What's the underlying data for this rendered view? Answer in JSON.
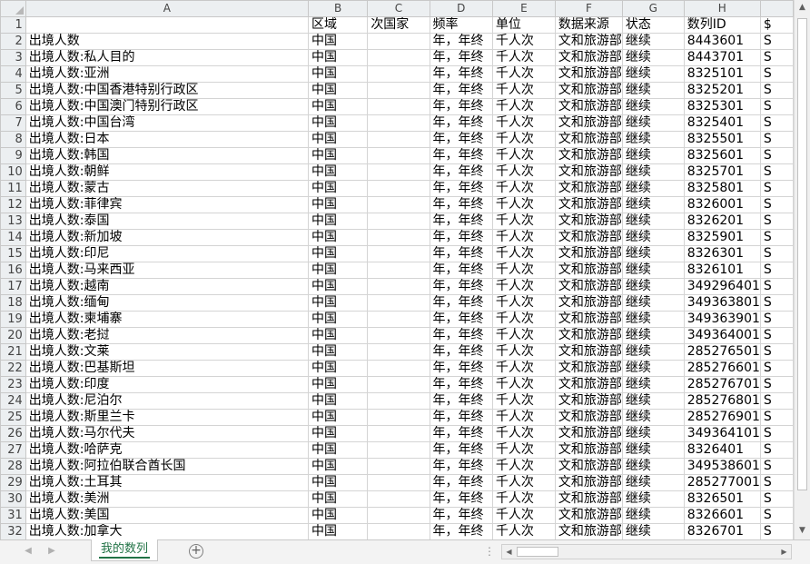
{
  "columns": [
    "A",
    "B",
    "C",
    "D",
    "E",
    "F",
    "G",
    "H",
    ""
  ],
  "header_row": {
    "num": "1",
    "cells": [
      "",
      "区域",
      "次国家",
      "频率",
      "单位",
      "数据来源",
      "状态",
      "数列ID",
      "$"
    ]
  },
  "rows": [
    {
      "num": "2",
      "cells": [
        "出境人数",
        "中国",
        "",
        "年，年终",
        "千人次",
        "文和旅游部",
        "继续",
        "8443601",
        "S"
      ]
    },
    {
      "num": "3",
      "cells": [
        "出境人数:私人目的",
        "中国",
        "",
        "年，年终",
        "千人次",
        "文和旅游部",
        "继续",
        "8443701",
        "S"
      ]
    },
    {
      "num": "4",
      "cells": [
        "出境人数:亚洲",
        "中国",
        "",
        "年，年终",
        "千人次",
        "文和旅游部",
        "继续",
        "8325101",
        "S"
      ]
    },
    {
      "num": "5",
      "cells": [
        "出境人数:中国香港特别行政区",
        "中国",
        "",
        "年，年终",
        "千人次",
        "文和旅游部",
        "继续",
        "8325201",
        "S"
      ]
    },
    {
      "num": "6",
      "cells": [
        "出境人数:中国澳门特别行政区",
        "中国",
        "",
        "年，年终",
        "千人次",
        "文和旅游部",
        "继续",
        "8325301",
        "S"
      ]
    },
    {
      "num": "7",
      "cells": [
        "出境人数:中国台湾",
        "中国",
        "",
        "年，年终",
        "千人次",
        "文和旅游部",
        "继续",
        "8325401",
        "S"
      ]
    },
    {
      "num": "8",
      "cells": [
        "出境人数:日本",
        "中国",
        "",
        "年，年终",
        "千人次",
        "文和旅游部",
        "继续",
        "8325501",
        "S"
      ]
    },
    {
      "num": "9",
      "cells": [
        "出境人数:韩国",
        "中国",
        "",
        "年，年终",
        "千人次",
        "文和旅游部",
        "继续",
        "8325601",
        "S"
      ]
    },
    {
      "num": "10",
      "cells": [
        "出境人数:朝鲜",
        "中国",
        "",
        "年，年终",
        "千人次",
        "文和旅游部",
        "继续",
        "8325701",
        "S"
      ]
    },
    {
      "num": "11",
      "cells": [
        "出境人数:蒙古",
        "中国",
        "",
        "年，年终",
        "千人次",
        "文和旅游部",
        "继续",
        "8325801",
        "S"
      ]
    },
    {
      "num": "12",
      "cells": [
        "出境人数:菲律宾",
        "中国",
        "",
        "年，年终",
        "千人次",
        "文和旅游部",
        "继续",
        "8326001",
        "S"
      ]
    },
    {
      "num": "13",
      "cells": [
        "出境人数:泰国",
        "中国",
        "",
        "年，年终",
        "千人次",
        "文和旅游部",
        "继续",
        "8326201",
        "S"
      ]
    },
    {
      "num": "14",
      "cells": [
        "出境人数:新加坡",
        "中国",
        "",
        "年，年终",
        "千人次",
        "文和旅游部",
        "继续",
        "8325901",
        "S"
      ]
    },
    {
      "num": "15",
      "cells": [
        "出境人数:印尼",
        "中国",
        "",
        "年，年终",
        "千人次",
        "文和旅游部",
        "继续",
        "8326301",
        "S"
      ]
    },
    {
      "num": "16",
      "cells": [
        "出境人数:马来西亚",
        "中国",
        "",
        "年，年终",
        "千人次",
        "文和旅游部",
        "继续",
        "8326101",
        "S"
      ]
    },
    {
      "num": "17",
      "cells": [
        "出境人数:越南",
        "中国",
        "",
        "年，年终",
        "千人次",
        "文和旅游部",
        "继续",
        "349296401",
        "S"
      ]
    },
    {
      "num": "18",
      "cells": [
        "出境人数:缅甸",
        "中国",
        "",
        "年，年终",
        "千人次",
        "文和旅游部",
        "继续",
        "349363801",
        "S"
      ]
    },
    {
      "num": "19",
      "cells": [
        "出境人数:柬埔寨",
        "中国",
        "",
        "年，年终",
        "千人次",
        "文和旅游部",
        "继续",
        "349363901",
        "S"
      ]
    },
    {
      "num": "20",
      "cells": [
        "出境人数:老挝",
        "中国",
        "",
        "年，年终",
        "千人次",
        "文和旅游部",
        "继续",
        "349364001",
        "S"
      ]
    },
    {
      "num": "21",
      "cells": [
        "出境人数:文莱",
        "中国",
        "",
        "年，年终",
        "千人次",
        "文和旅游部",
        "继续",
        "285276501",
        "S"
      ]
    },
    {
      "num": "22",
      "cells": [
        "出境人数:巴基斯坦",
        "中国",
        "",
        "年，年终",
        "千人次",
        "文和旅游部",
        "继续",
        "285276601",
        "S"
      ]
    },
    {
      "num": "23",
      "cells": [
        "出境人数:印度",
        "中国",
        "",
        "年，年终",
        "千人次",
        "文和旅游部",
        "继续",
        "285276701",
        "S"
      ]
    },
    {
      "num": "24",
      "cells": [
        "出境人数:尼泊尔",
        "中国",
        "",
        "年，年终",
        "千人次",
        "文和旅游部",
        "继续",
        "285276801",
        "S"
      ]
    },
    {
      "num": "25",
      "cells": [
        "出境人数:斯里兰卡",
        "中国",
        "",
        "年，年终",
        "千人次",
        "文和旅游部",
        "继续",
        "285276901",
        "S"
      ]
    },
    {
      "num": "26",
      "cells": [
        "出境人数:马尔代夫",
        "中国",
        "",
        "年，年终",
        "千人次",
        "文和旅游部",
        "继续",
        "349364101",
        "S"
      ]
    },
    {
      "num": "27",
      "cells": [
        "出境人数:哈萨克",
        "中国",
        "",
        "年，年终",
        "千人次",
        "文和旅游部",
        "继续",
        "8326401",
        "S"
      ]
    },
    {
      "num": "28",
      "cells": [
        "出境人数:阿拉伯联合酋长国",
        "中国",
        "",
        "年，年终",
        "千人次",
        "文和旅游部",
        "继续",
        "349538601",
        "S"
      ]
    },
    {
      "num": "29",
      "cells": [
        "出境人数:土耳其",
        "中国",
        "",
        "年，年终",
        "千人次",
        "文和旅游部",
        "继续",
        "285277001",
        "S"
      ]
    },
    {
      "num": "30",
      "cells": [
        "出境人数:美洲",
        "中国",
        "",
        "年，年终",
        "千人次",
        "文和旅游部",
        "继续",
        "8326501",
        "S"
      ]
    },
    {
      "num": "31",
      "cells": [
        "出境人数:美国",
        "中国",
        "",
        "年，年终",
        "千人次",
        "文和旅游部",
        "继续",
        "8326601",
        "S"
      ]
    },
    {
      "num": "32",
      "cells": [
        "出境人数:加拿大",
        "中国",
        "",
        "年，年终",
        "千人次",
        "文和旅游部",
        "继续",
        "8326701",
        "S"
      ]
    }
  ],
  "sheet_tab": {
    "label": "我的数列"
  },
  "icons": {
    "add_sheet": "plus-circle-icon",
    "nav_prev": "triangle-left-icon",
    "nav_next": "triangle-right-icon"
  },
  "colors": {
    "accent": "#217346",
    "header_bg": "#eceff1",
    "grid": "#d4d4d4"
  }
}
